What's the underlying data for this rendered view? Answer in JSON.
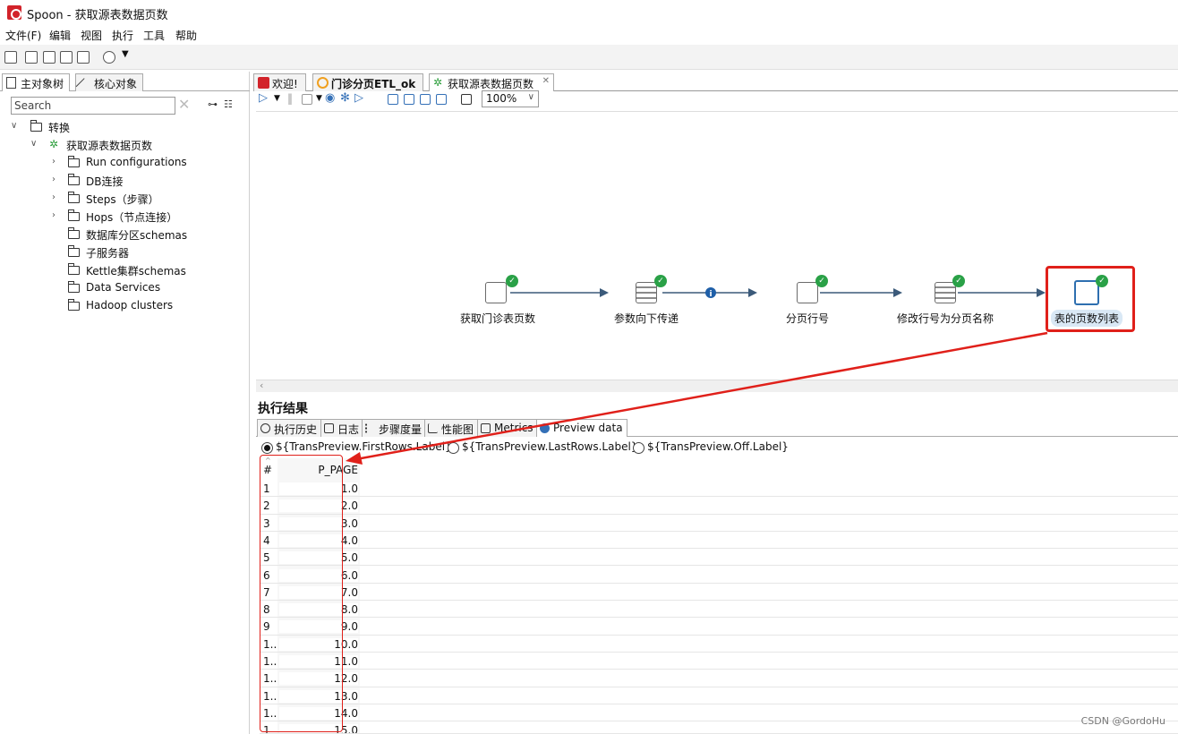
{
  "window": {
    "title": "Spoon - 获取源表数据页数"
  },
  "menu": [
    "文件(F)",
    "编辑",
    "视图",
    "执行",
    "工具",
    "帮助"
  ],
  "left_panel": {
    "tabs": [
      "主对象树",
      "核心对象"
    ],
    "search_placeholder": "Search",
    "tree": {
      "root": "转换",
      "transformation": "获取源表数据页数",
      "children": [
        "Run configurations",
        "DB连接",
        "Steps（步骤）",
        "Hops（节点连接）",
        "数据库分区schemas",
        "子服务器",
        "Kettle集群schemas",
        "Data Services",
        "Hadoop clusters"
      ]
    }
  },
  "editor_tabs": [
    "欢迎!",
    "门诊分页ETL_ok",
    "获取源表数据页数"
  ],
  "canvas_toolbar": {
    "zoom": "100%"
  },
  "steps": [
    {
      "label": "获取门诊表页数",
      "status": "ok"
    },
    {
      "label": "参数向下传递",
      "status": "ok"
    },
    {
      "label": "分页行号",
      "status": "ok"
    },
    {
      "label": "修改行号为分页名称",
      "status": "ok"
    },
    {
      "label": "表的页数列表",
      "status": "ok",
      "selected": true
    }
  ],
  "hop_info_icon": "info-icon",
  "results": {
    "title": "执行结果",
    "tabs": [
      "执行历史",
      "日志",
      "步骤度量",
      "性能图",
      "Metrics",
      "Preview data"
    ],
    "radios": [
      "${TransPreview.FirstRows.Label}",
      "${TransPreview.LastRows.Label}",
      "${TransPreview.Off.Label}"
    ],
    "columns": [
      "#",
      "P_PAGE"
    ],
    "rows": [
      [
        "1",
        "1.0"
      ],
      [
        "2",
        "2.0"
      ],
      [
        "3",
        "3.0"
      ],
      [
        "4",
        "4.0"
      ],
      [
        "5",
        "5.0"
      ],
      [
        "6",
        "6.0"
      ],
      [
        "7",
        "7.0"
      ],
      [
        "8",
        "8.0"
      ],
      [
        "9",
        "9.0"
      ],
      [
        "1..",
        "10.0"
      ],
      [
        "1..",
        "11.0"
      ],
      [
        "1..",
        "12.0"
      ],
      [
        "1..",
        "13.0"
      ],
      [
        "1..",
        "14.0"
      ],
      [
        "1",
        "15.0"
      ]
    ]
  },
  "watermark": "CSDN @GordoHu",
  "colors": {
    "annotation": "#e0201a",
    "ok": "#2aa147",
    "accent": "#2e6fb0"
  }
}
